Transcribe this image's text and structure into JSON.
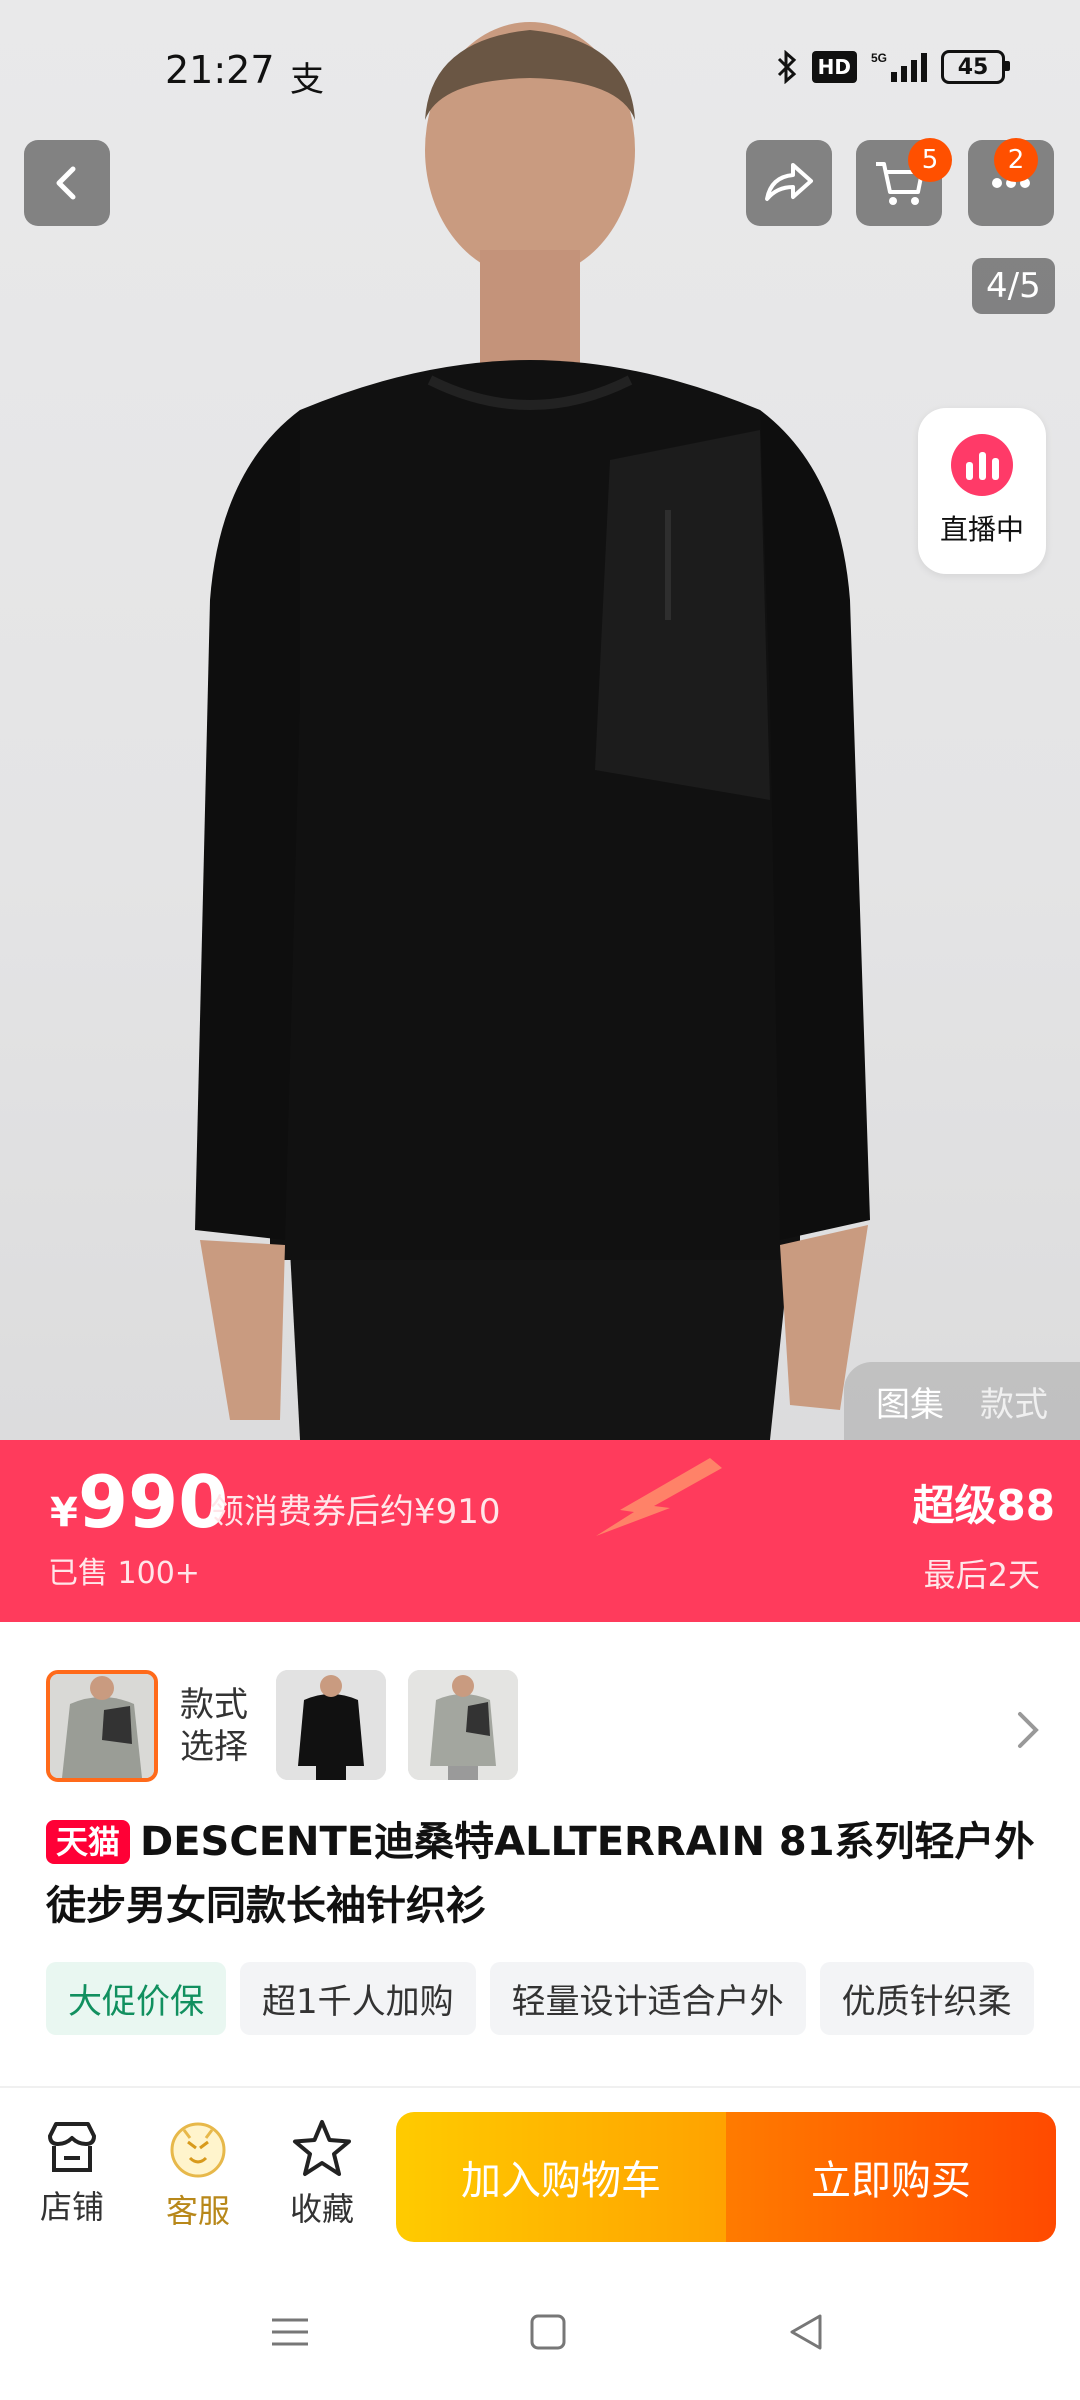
{
  "status_bar": {
    "time": "21:27",
    "network": "5G",
    "hd": "HD",
    "battery": "45"
  },
  "top_bar": {
    "cart_badge": "5",
    "more_badge": "2",
    "image_counter": "4/5",
    "live_label": "直播中"
  },
  "gallery_tabs": [
    "图集",
    "款式"
  ],
  "price_banner": {
    "currency": "¥",
    "price": "990",
    "coupon_text": "领消费券后约¥910",
    "sold_text": "已售 100+",
    "event": "超级88",
    "ends": "最后2天"
  },
  "variants": {
    "label": "款式选择"
  },
  "product": {
    "badge": "天猫",
    "title": "DESCENTE迪桑特ALLTERRAIN 81系列轻户外徒步男女同款长袖针织衫"
  },
  "tags": [
    "大促价保",
    "超1千人加购",
    "轻量设计适合户外",
    "优质针织柔"
  ],
  "bottom_bar": {
    "shop": "店铺",
    "service": "客服",
    "favorite": "收藏",
    "add_to_cart": "加入购物车",
    "buy_now": "立即购买"
  },
  "colors": {
    "accent": "#ff3b5c",
    "tmall": "#ff0036",
    "cart": "#ffa200",
    "buy": "#ff4a00"
  }
}
